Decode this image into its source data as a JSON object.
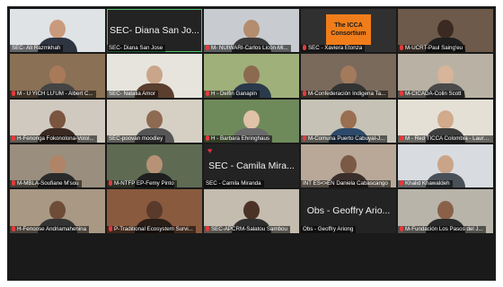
{
  "tiles": [
    {
      "label": "SEC- Ali Razmkhah",
      "mic": false
    },
    {
      "label": "SEC- Diana San Jose",
      "center": "SEC- Diana San Jo...",
      "mic": false
    },
    {
      "label": "M- NUIWARI-Carlos Licón-Mi...",
      "mic": true
    },
    {
      "label": "SEC - Xaviera Etonza",
      "logo_line1": "The ICCA",
      "logo_line2": "Consortium",
      "mic": true
    },
    {
      "label": "M-UCRT-Paul Saing'eu",
      "mic": true
    },
    {
      "label": "M - U YICH LU'UM - Albert C...",
      "mic": true
    },
    {
      "label": "SEC- Natalia Amor",
      "mic": false
    },
    {
      "label": "H - Delfin Ganapin",
      "mic": true
    },
    {
      "label": "M-Confederación Indigena Ta...",
      "mic": true
    },
    {
      "label": "M-CICADA-Colin Scott",
      "mic": true
    },
    {
      "label": "H-Fenonga Fokonolona-Volol...",
      "mic": true
    },
    {
      "label": "SEC-poovan moodley",
      "mic": false
    },
    {
      "label": "H - Barbara Ehringhaus",
      "mic": true
    },
    {
      "label": "M-Comuna Puerto Cabuyal-J...",
      "mic": true
    },
    {
      "label": "M - Red TICCA Colombia - Laura...",
      "mic": true
    },
    {
      "label": "M-MBLA-Soufiane M'sou",
      "mic": true
    },
    {
      "label": "M-NTFP EP-Femy Pinto",
      "mic": true
    },
    {
      "label": "SEC - Camila Miranda",
      "center": "SEC - Camila Mira...",
      "mic": false,
      "heart": "♥"
    },
    {
      "label": "INT ES<>EN Daniela Cabascango",
      "mic": false
    },
    {
      "label": "Khalid Khawaldeh",
      "mic": true
    },
    {
      "label": "H-Fenoose Andriamahenina",
      "mic": true
    },
    {
      "label": "P-Traditional Ecosystem Survi...",
      "mic": true
    },
    {
      "label": "SEC-APCRM-Salatou Sambou",
      "mic": true
    },
    {
      "label": "Obs - Geoffry Ariong",
      "center": "Obs - Geoffry Ario...",
      "mic": false
    },
    {
      "label": "M-Fundación Los Pasos del J...",
      "mic": true
    }
  ],
  "colors": {
    "muted_mic": "#e23b3b",
    "active_speaker_border": "#4cc46a",
    "logo_background": "#f07d1a"
  }
}
